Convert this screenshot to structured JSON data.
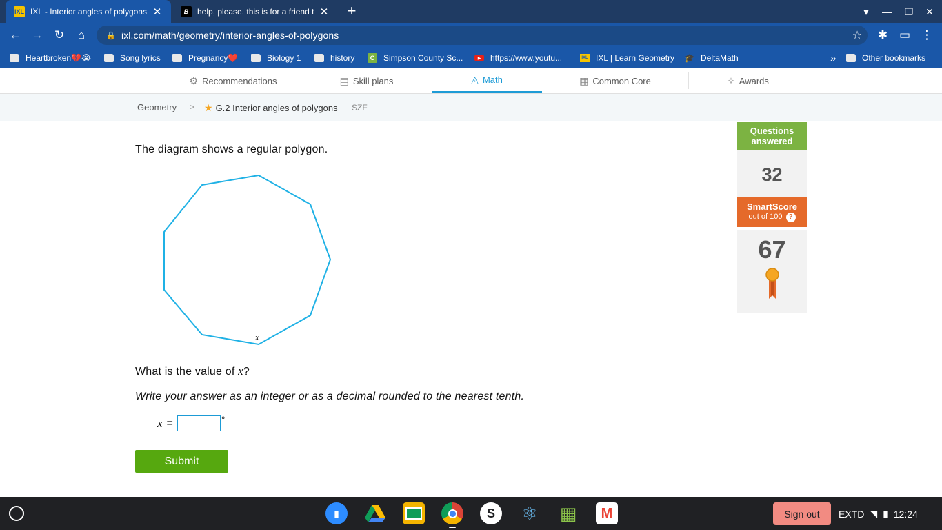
{
  "browser": {
    "tabs": [
      {
        "title": "IXL - Interior angles of polygons (",
        "favicon": "IXL",
        "active": true
      },
      {
        "title": "help, please. this is for a friend to",
        "favicon": "B",
        "active": false
      }
    ],
    "new_tab_icon": "plus-icon",
    "window_controls": [
      "dropdown-icon",
      "minimize-icon",
      "restore-icon",
      "close-icon"
    ],
    "url": "ixl.com/math/geometry/interior-angles-of-polygons",
    "bookmarks": [
      {
        "label": "Heartbroken💔😭",
        "icon": "folder"
      },
      {
        "label": "Song lyrics",
        "icon": "folder"
      },
      {
        "label": "Pregnancy❤️",
        "icon": "folder"
      },
      {
        "label": "Biology 1",
        "icon": "folder"
      },
      {
        "label": "history",
        "icon": "folder"
      },
      {
        "label": "Simpson County Sc...",
        "icon": "classlink"
      },
      {
        "label": "https://www.youtu...",
        "icon": "youtube"
      },
      {
        "label": "IXL | Learn Geometry",
        "icon": "ixl"
      },
      {
        "label": "DeltaMath",
        "icon": "deltamath"
      }
    ],
    "overflow_label": "»",
    "other_bookmarks": "Other bookmarks"
  },
  "ixl_nav": {
    "items": [
      {
        "label": "Recommendations",
        "icon": "recommendations-icon",
        "active": false
      },
      {
        "label": "Skill plans",
        "icon": "skill-plans-icon",
        "active": false
      },
      {
        "label": "Math",
        "icon": "math-icon",
        "active": true
      },
      {
        "label": "Common Core",
        "icon": "common-core-icon",
        "active": false
      },
      {
        "label": "Awards",
        "icon": "awards-icon",
        "active": false
      }
    ]
  },
  "breadcrumb": {
    "subject": "Geometry",
    "separator": ">",
    "skill": "G.2 Interior angles of polygons",
    "code": "SZF"
  },
  "question": {
    "intro": "The diagram shows a regular polygon.",
    "diagram_label": "x",
    "prompt_before": "What is the value of ",
    "prompt_var": "x",
    "prompt_after": "?",
    "instruction": "Write your answer as an integer or as a decimal rounded to the nearest tenth.",
    "answer_var": "x",
    "answer_eq": "=",
    "answer_value": "",
    "degree_symbol": "°",
    "submit_label": "Submit"
  },
  "stats": {
    "questions_answered_label_1": "Questions",
    "questions_answered_label_2": "answered",
    "questions_answered": "32",
    "smartscore_label": "SmartScore",
    "smartscore_sub": "out of 100",
    "smartscore_help": "?",
    "smartscore": "67",
    "accent_green": "#7cb342",
    "accent_orange": "#e56a2a"
  },
  "taskbar": {
    "apps": [
      "zoom-icon",
      "google-drive-icon",
      "google-classroom-icon",
      "chrome-icon",
      "s-app-icon",
      "atom-icon",
      "geogebra-icon",
      "gmail-icon"
    ],
    "sign_out": "Sign out",
    "keyboard": "EXTD",
    "time": "12:24"
  }
}
